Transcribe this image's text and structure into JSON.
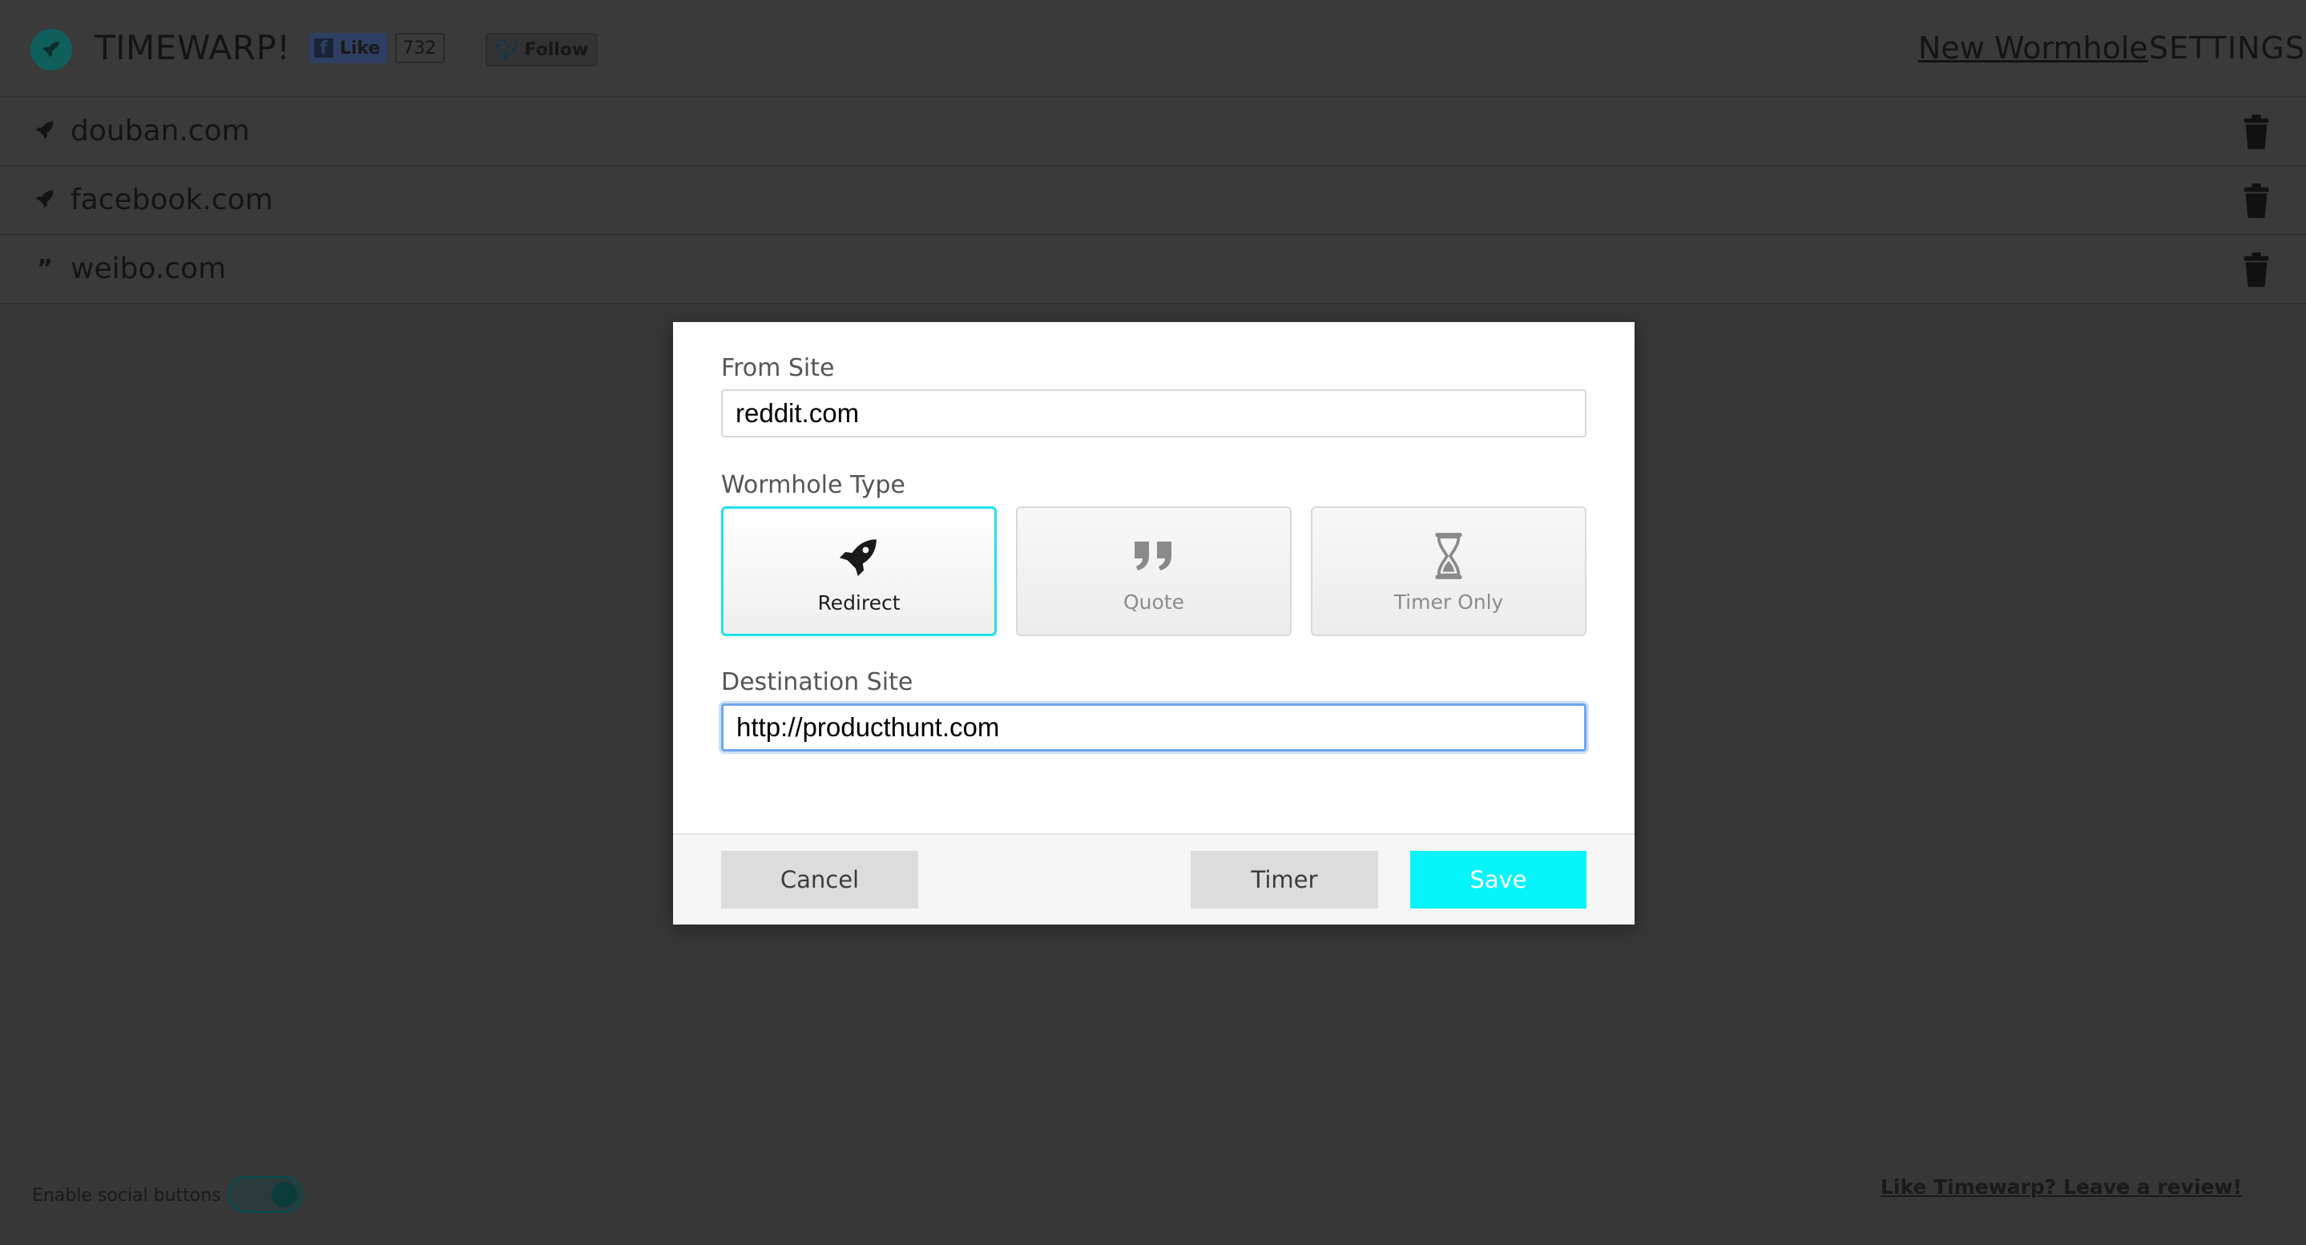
{
  "app": {
    "title": "TIMEWARP!",
    "logo_icon": "rocket-icon",
    "brand_color": "#0f5f5c"
  },
  "social": {
    "like_label": "Like",
    "like_count": "732",
    "follow_label": "Follow"
  },
  "nav": {
    "new_wormhole": "New Wormhole",
    "settings": "SETTINGS"
  },
  "wormholes": [
    {
      "site": "douban.com",
      "type_icon": "rocket-icon",
      "action_icon": "trash-icon"
    },
    {
      "site": "facebook.com",
      "type_icon": "rocket-icon",
      "action_icon": "trash-icon"
    },
    {
      "site": "weibo.com",
      "type_icon": "quote-icon",
      "action_icon": "trash-icon"
    }
  ],
  "modal": {
    "from_site": {
      "label": "From Site",
      "value": "reddit.com"
    },
    "wormhole_type": {
      "label": "Wormhole Type",
      "options": [
        {
          "label": "Redirect",
          "icon": "rocket-icon",
          "selected": true
        },
        {
          "label": "Quote",
          "icon": "quote-icon",
          "selected": false
        },
        {
          "label": "Timer Only",
          "icon": "hourglass-icon",
          "selected": false
        }
      ],
      "selected_color": "#1be3ee"
    },
    "destination_site": {
      "label": "Destination Site",
      "value": "http://producthunt.com",
      "focused": true
    },
    "buttons": {
      "cancel": "Cancel",
      "timer": "Timer",
      "save": "Save",
      "save_color": "#05f5fa"
    }
  },
  "footer": {
    "social_toggle_label": "Enable social buttons",
    "social_toggle_on": true,
    "review_link": "Like Timewarp? Leave a review!"
  }
}
